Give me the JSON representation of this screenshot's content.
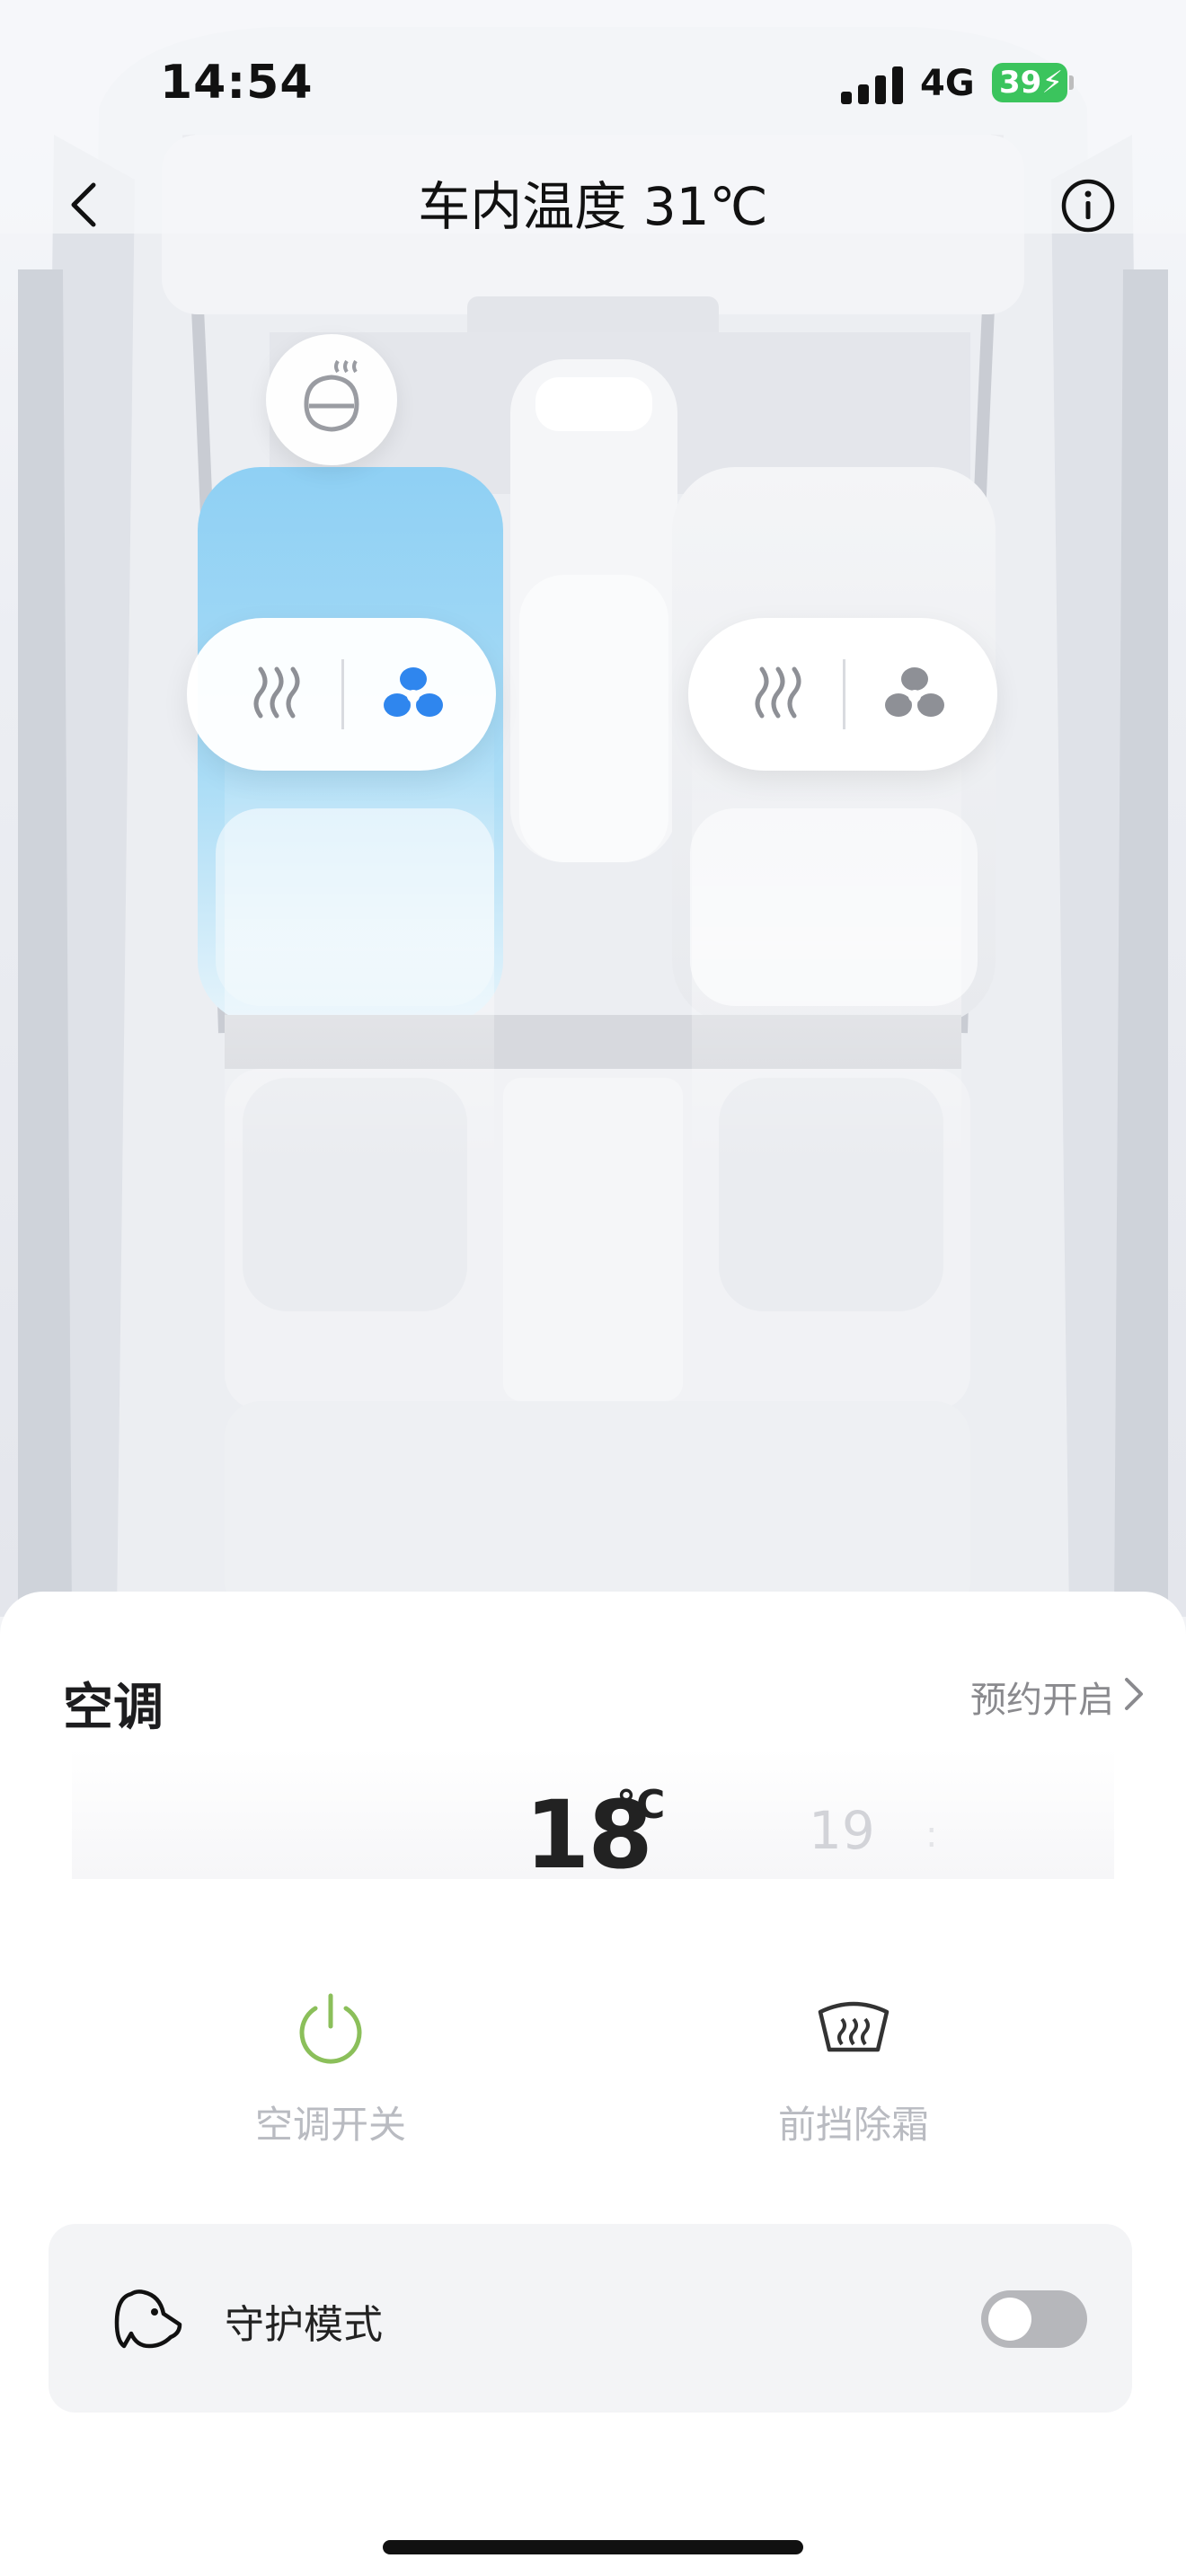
{
  "status_bar": {
    "time": "14:54",
    "network": "4G",
    "battery": "39"
  },
  "header": {
    "title": "车内温度 31℃"
  },
  "cabin": {
    "driver_seat": {
      "mode": "ventilation",
      "ventilation_active": true,
      "heating_active": false
    },
    "passenger_seat": {
      "ventilation_active": false,
      "heating_active": false
    },
    "steering_wheel_heat_active": false
  },
  "ac": {
    "title": "空调",
    "schedule_label": "预约开启",
    "temp_value": "18",
    "temp_unit": "°C",
    "temp_next": "19",
    "temp_next2": ":",
    "power_label": "空调开关",
    "defrost_label": "前挡除霜"
  },
  "guard": {
    "label": "守护模式",
    "enabled": false
  },
  "colors": {
    "accent_blue": "#2f86ee",
    "power_green": "#8bbf5a",
    "seat_cool": "#9fd6f5"
  }
}
